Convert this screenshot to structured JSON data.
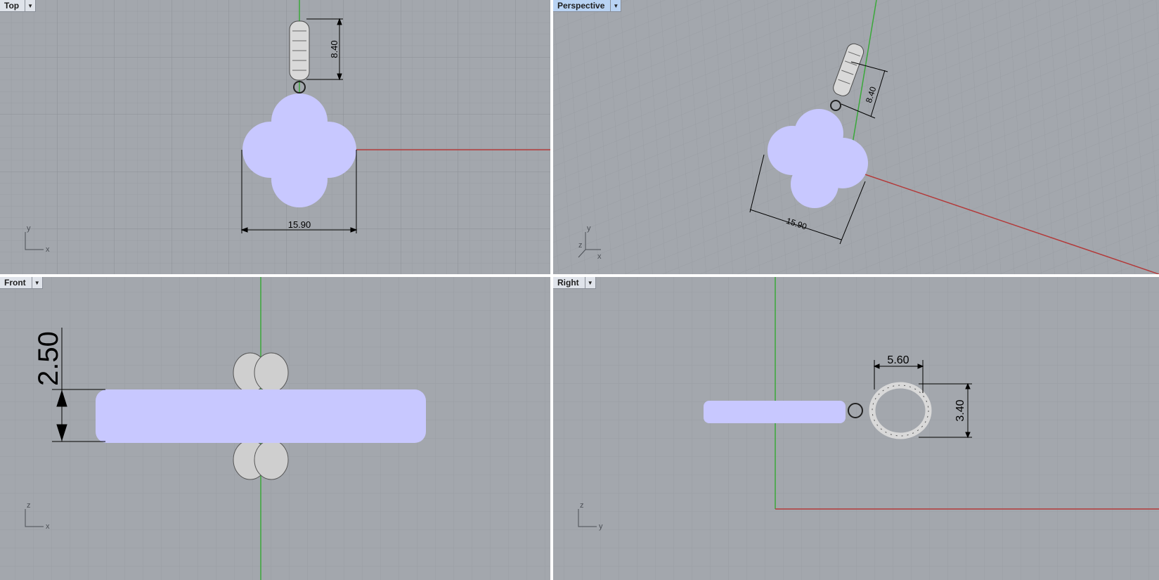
{
  "viewports": {
    "top": {
      "label": "Top",
      "dimension": "15.90",
      "dimension2": "8.40",
      "axes": {
        "a": "y",
        "b": "x"
      }
    },
    "perspective": {
      "label": "Perspective",
      "dimension": "15.90",
      "dimension2": "8.40",
      "axes": {
        "a": "y",
        "b": "z",
        "c": "x"
      }
    },
    "front": {
      "label": "Front",
      "dimension": "2.50",
      "axes": {
        "a": "z",
        "b": "x"
      }
    },
    "right": {
      "label": "Right",
      "dimension": "5.60",
      "dimension2": "3.40",
      "axes": {
        "a": "z",
        "b": "y"
      }
    }
  },
  "colors": {
    "viewport_bg": "#a3a7ad",
    "grid_minor": "#989ca2",
    "grid_major": "#888c92",
    "x_axis": "#b33a3a",
    "y_axis": "#3aa83a",
    "model_fill": "#c8c8ff",
    "active_tab": "#b9d3f3",
    "tab": "#dfe3ea",
    "separator": "#ffffff"
  },
  "icons": {
    "dropdown": "chevron-down-icon"
  }
}
